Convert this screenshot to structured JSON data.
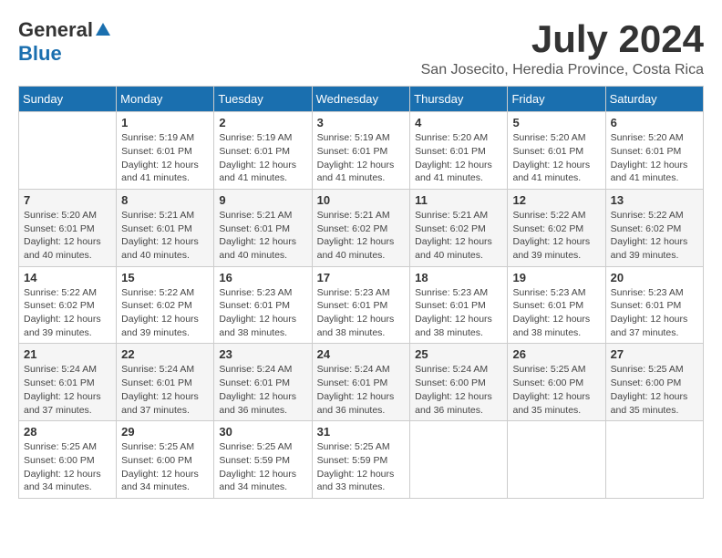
{
  "header": {
    "logo_general": "General",
    "logo_blue": "Blue",
    "month_title": "July 2024",
    "location": "San Josecito, Heredia Province, Costa Rica"
  },
  "calendar": {
    "days_of_week": [
      "Sunday",
      "Monday",
      "Tuesday",
      "Wednesday",
      "Thursday",
      "Friday",
      "Saturday"
    ],
    "weeks": [
      [
        {
          "day": "",
          "info": ""
        },
        {
          "day": "1",
          "info": "Sunrise: 5:19 AM\nSunset: 6:01 PM\nDaylight: 12 hours\nand 41 minutes."
        },
        {
          "day": "2",
          "info": "Sunrise: 5:19 AM\nSunset: 6:01 PM\nDaylight: 12 hours\nand 41 minutes."
        },
        {
          "day": "3",
          "info": "Sunrise: 5:19 AM\nSunset: 6:01 PM\nDaylight: 12 hours\nand 41 minutes."
        },
        {
          "day": "4",
          "info": "Sunrise: 5:20 AM\nSunset: 6:01 PM\nDaylight: 12 hours\nand 41 minutes."
        },
        {
          "day": "5",
          "info": "Sunrise: 5:20 AM\nSunset: 6:01 PM\nDaylight: 12 hours\nand 41 minutes."
        },
        {
          "day": "6",
          "info": "Sunrise: 5:20 AM\nSunset: 6:01 PM\nDaylight: 12 hours\nand 41 minutes."
        }
      ],
      [
        {
          "day": "7",
          "info": "Sunrise: 5:20 AM\nSunset: 6:01 PM\nDaylight: 12 hours\nand 40 minutes."
        },
        {
          "day": "8",
          "info": "Sunrise: 5:21 AM\nSunset: 6:01 PM\nDaylight: 12 hours\nand 40 minutes."
        },
        {
          "day": "9",
          "info": "Sunrise: 5:21 AM\nSunset: 6:01 PM\nDaylight: 12 hours\nand 40 minutes."
        },
        {
          "day": "10",
          "info": "Sunrise: 5:21 AM\nSunset: 6:02 PM\nDaylight: 12 hours\nand 40 minutes."
        },
        {
          "day": "11",
          "info": "Sunrise: 5:21 AM\nSunset: 6:02 PM\nDaylight: 12 hours\nand 40 minutes."
        },
        {
          "day": "12",
          "info": "Sunrise: 5:22 AM\nSunset: 6:02 PM\nDaylight: 12 hours\nand 39 minutes."
        },
        {
          "day": "13",
          "info": "Sunrise: 5:22 AM\nSunset: 6:02 PM\nDaylight: 12 hours\nand 39 minutes."
        }
      ],
      [
        {
          "day": "14",
          "info": "Sunrise: 5:22 AM\nSunset: 6:02 PM\nDaylight: 12 hours\nand 39 minutes."
        },
        {
          "day": "15",
          "info": "Sunrise: 5:22 AM\nSunset: 6:02 PM\nDaylight: 12 hours\nand 39 minutes."
        },
        {
          "day": "16",
          "info": "Sunrise: 5:23 AM\nSunset: 6:01 PM\nDaylight: 12 hours\nand 38 minutes."
        },
        {
          "day": "17",
          "info": "Sunrise: 5:23 AM\nSunset: 6:01 PM\nDaylight: 12 hours\nand 38 minutes."
        },
        {
          "day": "18",
          "info": "Sunrise: 5:23 AM\nSunset: 6:01 PM\nDaylight: 12 hours\nand 38 minutes."
        },
        {
          "day": "19",
          "info": "Sunrise: 5:23 AM\nSunset: 6:01 PM\nDaylight: 12 hours\nand 38 minutes."
        },
        {
          "day": "20",
          "info": "Sunrise: 5:23 AM\nSunset: 6:01 PM\nDaylight: 12 hours\nand 37 minutes."
        }
      ],
      [
        {
          "day": "21",
          "info": "Sunrise: 5:24 AM\nSunset: 6:01 PM\nDaylight: 12 hours\nand 37 minutes."
        },
        {
          "day": "22",
          "info": "Sunrise: 5:24 AM\nSunset: 6:01 PM\nDaylight: 12 hours\nand 37 minutes."
        },
        {
          "day": "23",
          "info": "Sunrise: 5:24 AM\nSunset: 6:01 PM\nDaylight: 12 hours\nand 36 minutes."
        },
        {
          "day": "24",
          "info": "Sunrise: 5:24 AM\nSunset: 6:01 PM\nDaylight: 12 hours\nand 36 minutes."
        },
        {
          "day": "25",
          "info": "Sunrise: 5:24 AM\nSunset: 6:00 PM\nDaylight: 12 hours\nand 36 minutes."
        },
        {
          "day": "26",
          "info": "Sunrise: 5:25 AM\nSunset: 6:00 PM\nDaylight: 12 hours\nand 35 minutes."
        },
        {
          "day": "27",
          "info": "Sunrise: 5:25 AM\nSunset: 6:00 PM\nDaylight: 12 hours\nand 35 minutes."
        }
      ],
      [
        {
          "day": "28",
          "info": "Sunrise: 5:25 AM\nSunset: 6:00 PM\nDaylight: 12 hours\nand 34 minutes."
        },
        {
          "day": "29",
          "info": "Sunrise: 5:25 AM\nSunset: 6:00 PM\nDaylight: 12 hours\nand 34 minutes."
        },
        {
          "day": "30",
          "info": "Sunrise: 5:25 AM\nSunset: 5:59 PM\nDaylight: 12 hours\nand 34 minutes."
        },
        {
          "day": "31",
          "info": "Sunrise: 5:25 AM\nSunset: 5:59 PM\nDaylight: 12 hours\nand 33 minutes."
        },
        {
          "day": "",
          "info": ""
        },
        {
          "day": "",
          "info": ""
        },
        {
          "day": "",
          "info": ""
        }
      ]
    ]
  }
}
